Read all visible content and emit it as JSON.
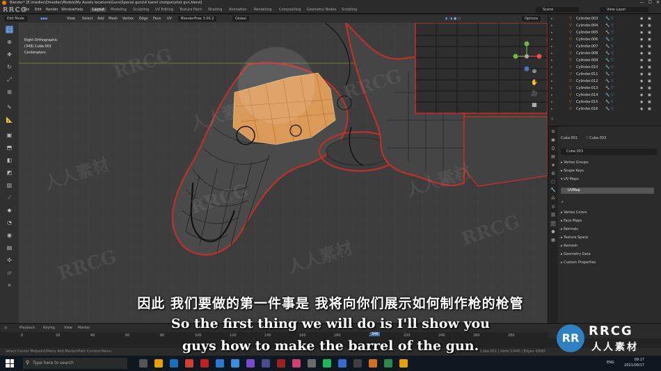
{
  "window": {
    "title": "Blender* [E:\\medlec\\Dmedlec\\Models\\My Assets locations\\Guns\\Special guns\\4 barrel shotgun\\shot gun.blend]",
    "controls": [
      "—",
      "☐",
      "✕"
    ]
  },
  "menubar": {
    "items": [
      "File",
      "Edit",
      "Render",
      "Window",
      "Help"
    ],
    "workspaces": [
      "Layout",
      "Modeling",
      "Sculpting",
      "UV Editing",
      "Texture Paint",
      "Shading",
      "Animation",
      "Rendering",
      "Compositing",
      "Geometry Nodes",
      "Scripting"
    ],
    "active_workspace": "Layout",
    "scene": "Scene",
    "view_layer": "View Layer"
  },
  "header": {
    "mode": "Edit Mode",
    "menus": [
      "View",
      "Select",
      "Add",
      "Mesh",
      "Vertex",
      "Edge",
      "Face",
      "UV"
    ],
    "addon": "BlenderFree 3.00.2",
    "orientation": "Global",
    "options": "Options"
  },
  "viewport": {
    "view_name": "Right Orthographic",
    "object": "(348) Cube.001",
    "units": "Centimeters"
  },
  "toolbar": {
    "tools": [
      "select-box",
      "cursor",
      "move",
      "rotate",
      "scale",
      "transform",
      "annotate",
      "measure",
      "add-cube",
      "extrude",
      "inset",
      "bevel",
      "loop-cut",
      "knife",
      "poly-build",
      "spin",
      "smooth",
      "edge-slide",
      "shrink-fatten",
      "shear",
      "rip"
    ]
  },
  "outliner": {
    "items": [
      "Cylinder.003",
      "Cylinder.004",
      "Cylinder.005",
      "Cylinder.006",
      "Cylinder.007",
      "Cylinder.008",
      "Cylinder.009",
      "Cylinder.010",
      "Cylinder.011",
      "Cylinder.012",
      "Cylinder.013",
      "Cylinder.014",
      "Cylinder.015",
      "Cylinder.016"
    ]
  },
  "properties": {
    "object_name": "Cube.001",
    "mesh_name": "Cube.003",
    "data_field": "Cube.003",
    "uv_map": "UVMap",
    "panels": [
      "Vertex Groups",
      "Shape Keys",
      "UV Maps",
      "Vertex Colors",
      "Face Maps",
      "Normals",
      "Texture Space",
      "Remesh",
      "Geometry Data",
      "Custom Properties"
    ]
  },
  "timeline": {
    "menus": [
      "Playback",
      "Keying",
      "View",
      "Marker"
    ],
    "ticks": [
      "0",
      "20",
      "40",
      "60",
      "80",
      "100",
      "120",
      "140",
      "160",
      "180",
      "200",
      "220",
      "240",
      "260",
      "280"
    ],
    "current_frame": "348"
  },
  "statusbar": {
    "left": "Select   Center   Midpoint/Menu  Add   Marker/Path   Context Menu",
    "right": "Cube.001 | Verts 2/440 | Edges 4/880"
  },
  "taskbar": {
    "search_placeholder": "Type here to search",
    "time": "09:17",
    "date": "2021/09/17",
    "lang": "ENG"
  },
  "subtitles": {
    "chinese": "因此 我们要做的第一件事是 我将向你们展示如何制作枪的枪管",
    "english_line1": "So the first thing we will do is I'll show you",
    "english_line2": "guys how to make the barrel of the gun."
  },
  "watermark": {
    "corner": "RRCG",
    "logo_mark": "RR",
    "logo_brand": "RRCG",
    "logo_cn": "人人素材"
  },
  "colors": {
    "accent": "#5680c2",
    "selection": "#e8a15a",
    "outline": "#c0302a",
    "mesh_icon": "#e88a2a"
  }
}
